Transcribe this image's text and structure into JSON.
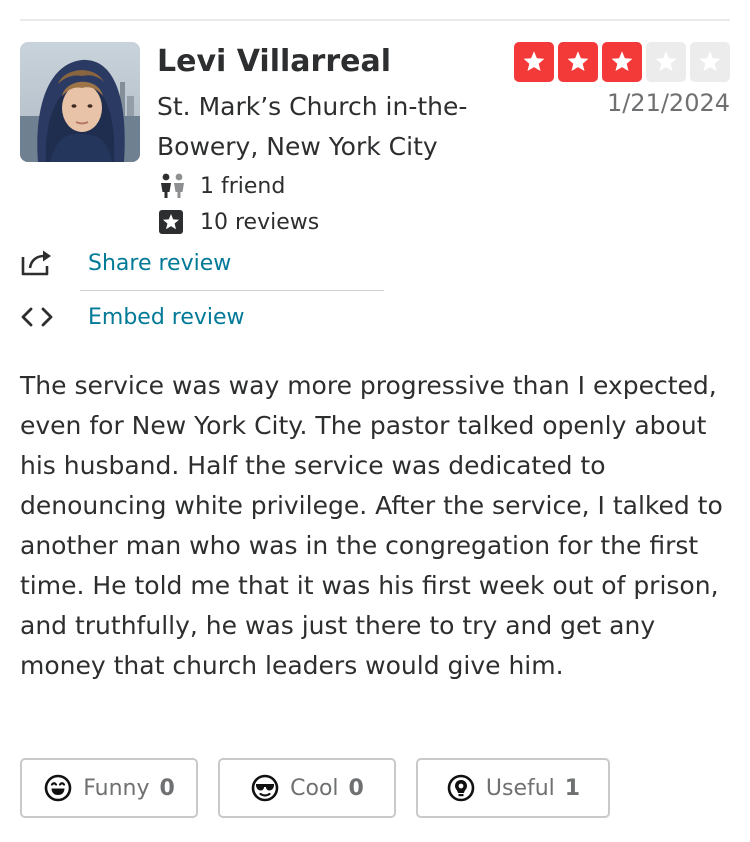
{
  "user": {
    "name": "Levi Villarreal",
    "location": "St. Mark’s Church in-the-Bowery, New York City",
    "friends_text": "1 friend",
    "reviews_text": "10 reviews",
    "avatar_icon": "user-avatar-photo"
  },
  "rating": {
    "value": 3,
    "max": 5,
    "filled_color": "#f43939",
    "empty_color": "#ececec"
  },
  "date": "1/21/2024",
  "actions": {
    "share_label": "Share review",
    "embed_label": "Embed review",
    "share_icon": "share-icon",
    "embed_icon": "embed-code-icon"
  },
  "review": {
    "text": "The service was way more progressive than I expected, even for New York City. The pastor talked openly about his husband. Half the service was dedicated to denouncing white privilege. After the service, I talked to another man who was in the congregation for the first time. He told me that it was his first week out of prison, and truthfully, he was just there to try and get any money that church leaders would give him."
  },
  "reactions": [
    {
      "label": "Funny",
      "count": "0",
      "icon": "funny-face-icon"
    },
    {
      "label": "Cool",
      "count": "0",
      "icon": "cool-sunglasses-icon"
    },
    {
      "label": "Useful",
      "count": "1",
      "icon": "useful-lightbulb-icon"
    }
  ],
  "colors": {
    "link": "#027a97",
    "text": "#2d2e2f",
    "muted": "#6e7072"
  }
}
